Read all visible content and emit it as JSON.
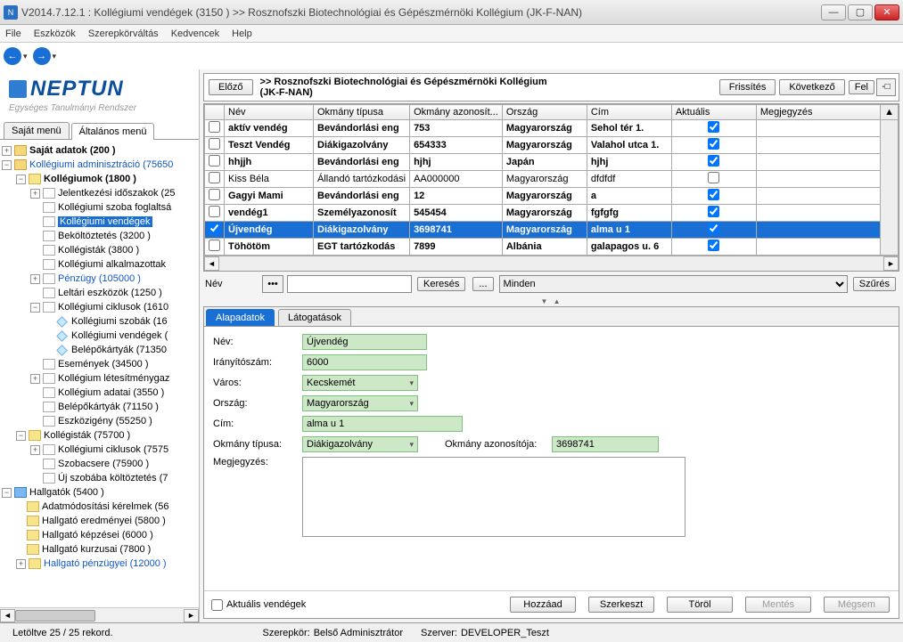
{
  "window": {
    "title": "V2014.7.12.1 : Kollégiumi vendégek (3150  )  >> Rosznofszki Biotechnológiai és Gépészmérnöki Kollégium (JK-F-NAN)",
    "icon_letter": "N"
  },
  "menu": {
    "file": "File",
    "tools": "Eszközök",
    "roles": "Szerepkörváltás",
    "fav": "Kedvencek",
    "help": "Help"
  },
  "logo": {
    "brand": "NEPTUN",
    "sub": "Egységes Tanulmányi Rendszer"
  },
  "left_tabs": {
    "own": "Saját menü",
    "gen": "Általános menü"
  },
  "tree": {
    "t0": "Saját adatok (200  )",
    "t1": "Kollégiumi adminisztráció (75650",
    "t2": "Kollégiumok (1800  )",
    "t3": "Jelentkezési időszakok (25",
    "t4": "Kollégiumi szoba foglaltsá",
    "t5": "Kollégiumi vendégek",
    "t6": "Beköltöztetés (3200  )",
    "t7": "Kollégisták (3800  )",
    "t8": "Kollégiumi alkalmazottak",
    "t9": "Pénzügy (105000  )",
    "t10": "Leltári eszközök (1250  )",
    "t11": "Kollégiumi ciklusok (1610",
    "t12": "Kollégiumi szobák (16",
    "t13": "Kollégiumi vendégek (",
    "t14": "Belépőkártyák (71350",
    "t15": "Események (34500  )",
    "t16": "Kollégium létesítménygaz",
    "t17": "Kollégium adatai (3550  )",
    "t18": "Belépőkártyák (71150  )",
    "t19": "Eszközigény (55250  )",
    "t20": "Kollégisták (75700  )",
    "t21": "Kollégiumi ciklusok (7575",
    "t22": "Szobacsere (75900  )",
    "t23": "Új szobába költöztetés (7",
    "t24": "Hallgatók (5400  )",
    "t25": "Adatmódosítási kérelmek (56",
    "t26": "Hallgató eredményei (5800  )",
    "t27": "Hallgató képzései (6000  )",
    "t28": "Hallgató kurzusai (7800  )",
    "t29": "Hallgató pénzügyei (12000  )"
  },
  "header": {
    "prev": "Előző",
    "breadcrumb_bold": ">> Rosznofszki Biotechnológiai és Gépészmérnöki Kollégium",
    "breadcrumb_sub": "(JK-F-NAN)",
    "refresh": "Frissítés",
    "next": "Következő",
    "up": "Fel"
  },
  "grid": {
    "cols": {
      "chk": "",
      "name": "Név",
      "doctype": "Okmány típusa",
      "docid": "Okmány azonosít...",
      "country": "Ország",
      "addr": "Cím",
      "current": "Aktuális",
      "note": "Megjegyzés"
    },
    "rows": [
      {
        "bold": true,
        "chk": false,
        "name": "aktív vendég",
        "doctype": "Bevándorlási eng",
        "docid": "753",
        "country": "Magyarország",
        "addr": "Sehol tér 1.",
        "current": true
      },
      {
        "bold": true,
        "chk": false,
        "name": "Teszt Vendég",
        "doctype": "Diákigazolvány",
        "docid": "654333",
        "country": "Magyarország",
        "addr": "Valahol utca 1.",
        "current": true
      },
      {
        "bold": true,
        "chk": false,
        "name": "hhjjh",
        "doctype": "Bevándorlási eng",
        "docid": "hjhj",
        "country": "Japán",
        "addr": "hjhj",
        "current": true
      },
      {
        "bold": false,
        "chk": false,
        "name": "Kiss Béla",
        "doctype": "Állandó tartózkodási",
        "docid": "AA000000",
        "country": "Magyarország",
        "addr": "dfdfdf",
        "current": false
      },
      {
        "bold": true,
        "chk": false,
        "name": "Gagyi Mami",
        "doctype": "Bevándorlási eng",
        "docid": "12",
        "country": "Magyarország",
        "addr": "a",
        "current": true
      },
      {
        "bold": true,
        "chk": false,
        "name": "vendég1",
        "doctype": "Személyazonosít",
        "docid": "545454",
        "country": "Magyarország",
        "addr": "fgfgfg",
        "current": true
      },
      {
        "bold": true,
        "sel": true,
        "chk": true,
        "name": "Újvendég",
        "doctype": "Diákigazolvány",
        "docid": "3698741",
        "country": "Magyarország",
        "addr": "alma u 1",
        "current": true
      },
      {
        "bold": true,
        "chk": false,
        "name": "Töhötöm",
        "doctype": "EGT tartózkodás",
        "docid": "7899",
        "country": "Albánia",
        "addr": "galapagos u. 6",
        "current": true
      }
    ]
  },
  "search": {
    "label": "Név",
    "btn_search": "Keresés",
    "dots": "...",
    "scope": "Minden",
    "filter": "Szűrés"
  },
  "detail_tabs": {
    "base": "Alapadatok",
    "visits": "Látogatások"
  },
  "form": {
    "name_l": "Név:",
    "name_v": "Újvendég",
    "zip_l": "Irányítószám:",
    "zip_v": "6000",
    "city_l": "Város:",
    "city_v": "Kecskemét",
    "country_l": "Ország:",
    "country_v": "Magyarország",
    "addr_l": "Cím:",
    "addr_v": "alma u 1",
    "doctype_l": "Okmány típusa:",
    "doctype_v": "Diákigazolvány",
    "docid_l": "Okmány azonosítója:",
    "docid_v": "3698741",
    "note_l": "Megjegyzés:"
  },
  "buttons": {
    "current_chk": "Aktuális vendégek",
    "add": "Hozzáad",
    "edit": "Szerkeszt",
    "del": "Töröl",
    "save": "Mentés",
    "cancel": "Mégsem"
  },
  "status": {
    "records": "Letöltve 25 / 25 rekord.",
    "role_l": "Szerepkör:",
    "role_v": "Belső Adminisztrátor",
    "srv_l": "Szerver:",
    "srv_v": "DEVELOPER_Teszt"
  }
}
